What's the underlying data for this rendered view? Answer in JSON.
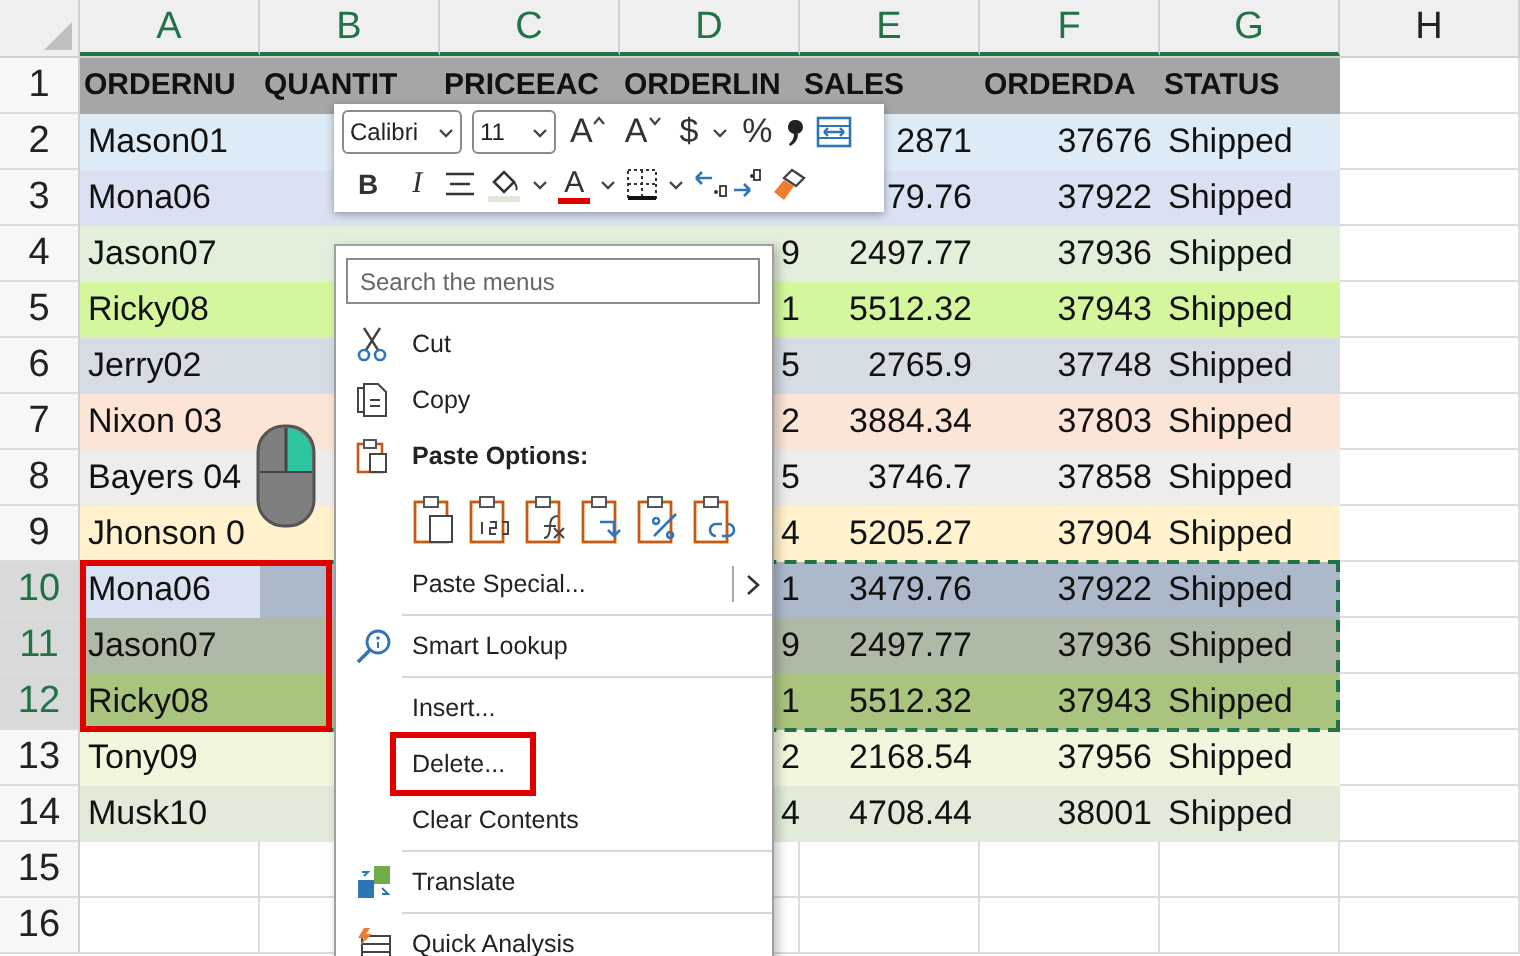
{
  "columns": [
    {
      "label": "A",
      "selected": true,
      "numeric": false
    },
    {
      "label": "B",
      "selected": true,
      "numeric": false
    },
    {
      "label": "C",
      "selected": true,
      "numeric": false
    },
    {
      "label": "D",
      "selected": true,
      "numeric": true
    },
    {
      "label": "E",
      "selected": true,
      "numeric": true
    },
    {
      "label": "F",
      "selected": true,
      "numeric": true
    },
    {
      "label": "G",
      "selected": true,
      "numeric": false
    },
    {
      "label": "H",
      "selected": false
    }
  ],
  "rows": [
    {
      "number": "1",
      "kind": "header",
      "color": "#a6a6a6",
      "selected": false,
      "highlighted": false,
      "cells": {
        "A": "ORDERNU",
        "B": "QUANTIT",
        "C": "PRICEEAC",
        "D": "ORDERLIN",
        "E": "SALES",
        "F": "ORDERDA",
        "G": "STATUS"
      }
    },
    {
      "number": "2",
      "kind": "data",
      "color": "#ddebf7",
      "selected": false,
      "highlighted": false,
      "cells": {
        "A": "Mason01",
        "E": "2871",
        "F": "37676",
        "G": "Shipped"
      }
    },
    {
      "number": "3",
      "kind": "data",
      "color": "#d9e1f2",
      "selected": false,
      "highlighted": false,
      "cells": {
        "A": "Mona06",
        "E": "79.76",
        "F": "37922",
        "G": "Shipped"
      }
    },
    {
      "number": "4",
      "kind": "data",
      "color": "#e2efda",
      "selected": false,
      "highlighted": false,
      "cells": {
        "A": "Jason07",
        "D": "9",
        "E": "2497.77",
        "F": "37936",
        "G": "Shipped"
      }
    },
    {
      "number": "5",
      "kind": "data",
      "color": "#d4f79e",
      "selected": false,
      "highlighted": false,
      "cells": {
        "A": "Ricky08",
        "D": "1",
        "E": "5512.32",
        "F": "37943",
        "G": "Shipped"
      }
    },
    {
      "number": "6",
      "kind": "data",
      "color": "#d6dce4",
      "selected": false,
      "highlighted": false,
      "cells": {
        "A": "Jerry02",
        "D": "5",
        "E": "2765.9",
        "F": "37748",
        "G": "Shipped"
      }
    },
    {
      "number": "7",
      "kind": "data",
      "color": "#fce4d6",
      "selected": false,
      "highlighted": false,
      "cells": {
        "A": "Nixon 03",
        "D": "2",
        "E": "3884.34",
        "F": "37803",
        "G": "Shipped"
      }
    },
    {
      "number": "8",
      "kind": "data",
      "color": "#ededed",
      "selected": false,
      "highlighted": false,
      "cells": {
        "A": "Bayers 04",
        "D": "5",
        "E": "3746.7",
        "F": "37858",
        "G": "Shipped"
      }
    },
    {
      "number": "9",
      "kind": "data",
      "color": "#fff2cc",
      "selected": false,
      "highlighted": false,
      "cells": {
        "A": "Jhonson 0",
        "D": "4",
        "E": "5205.27",
        "F": "37904",
        "G": "Shipped"
      }
    },
    {
      "number": "10",
      "kind": "data",
      "color": "#acb9ca",
      "first_cell": {
        "color": "#d9e1f2"
      },
      "selected": true,
      "highlighted": true,
      "cells": {
        "A": "Mona06",
        "D": "1",
        "E": "3479.76",
        "F": "37922",
        "G": "Shipped"
      }
    },
    {
      "number": "11",
      "kind": "data",
      "color": "#aeb9a6",
      "selected": true,
      "highlighted": true,
      "cells": {
        "A": "Jason07",
        "D": "9",
        "E": "2497.77",
        "F": "37936",
        "G": "Shipped"
      }
    },
    {
      "number": "12",
      "kind": "data",
      "color": "#a9c47f",
      "selected": true,
      "highlighted": true,
      "cells": {
        "A": "Ricky08",
        "D": "1",
        "E": "5512.32",
        "F": "37943",
        "G": "Shipped"
      }
    },
    {
      "number": "13",
      "kind": "data",
      "color": "#f0f7dc",
      "selected": false,
      "highlighted": false,
      "cells": {
        "A": "Tony09",
        "D": "2",
        "E": "2168.54",
        "F": "37956",
        "G": "Shipped"
      }
    },
    {
      "number": "14",
      "kind": "data",
      "color": "#e2ebda",
      "selected": false,
      "highlighted": false,
      "cells": {
        "A": "Musk10",
        "D": "4",
        "E": "4708.44",
        "F": "38001",
        "G": "Shipped"
      }
    },
    {
      "number": "15",
      "kind": "empty",
      "selected": false,
      "highlighted": false
    },
    {
      "number": "16",
      "kind": "empty",
      "selected": false,
      "highlighted": false
    }
  ],
  "mini_toolbar": {
    "rows": [
      [
        {
          "kind": "dropdown",
          "value": "Calibri"
        },
        {
          "kind": "dropdown",
          "value": "11"
        },
        {
          "kind": "grow",
          "label": "A"
        },
        {
          "kind": "shrink",
          "label": "A"
        },
        {
          "kind": "glyph",
          "label": "$"
        },
        {
          "kind": "caret"
        },
        {
          "kind": "glyph",
          "label": "%"
        },
        {
          "kind": "icon"
        },
        {
          "kind": "icon"
        }
      ],
      [
        {
          "kind": "bold",
          "label": "B"
        },
        {
          "kind": "italic",
          "label": "I"
        },
        {
          "kind": "icon"
        },
        {
          "kind": "icon"
        },
        {
          "kind": "caret"
        },
        {
          "kind": "font-color",
          "label": "A"
        },
        {
          "kind": "caret"
        },
        {
          "kind": "icon"
        },
        {
          "kind": "caret"
        },
        {
          "kind": "icon"
        },
        {
          "kind": "icon"
        }
      ]
    ]
  },
  "context_menu": {
    "search": {
      "placeholder": "Search the menus"
    },
    "items": [
      {
        "kind": "command",
        "label": "Cut",
        "highlighted": false
      },
      {
        "kind": "command",
        "label": "Copy",
        "highlighted": false
      },
      {
        "kind": "header",
        "label": "Paste Options:"
      },
      {
        "kind": "paste-row",
        "options": [
          {
            "kind": "keep-source"
          },
          {
            "kind": "values"
          },
          {
            "kind": "formulas"
          },
          {
            "kind": "transpose"
          },
          {
            "kind": "formatting"
          },
          {
            "kind": "link"
          }
        ]
      },
      {
        "kind": "command",
        "label": "Paste Special...",
        "submenu": true,
        "highlighted": false
      },
      {
        "kind": "separator"
      },
      {
        "kind": "command",
        "label": "Smart Lookup",
        "highlighted": false
      },
      {
        "kind": "separator"
      },
      {
        "kind": "command",
        "label": "Insert...",
        "highlighted": false
      },
      {
        "kind": "command",
        "label": "Delete...",
        "highlighted": true
      },
      {
        "kind": "command",
        "label": "Clear Contents",
        "highlighted": false
      },
      {
        "kind": "separator"
      },
      {
        "kind": "command",
        "label": "Translate",
        "highlighted": false
      },
      {
        "kind": "separator"
      },
      {
        "kind": "command",
        "label": "Quick Analysis",
        "highlighted": false
      }
    ]
  }
}
